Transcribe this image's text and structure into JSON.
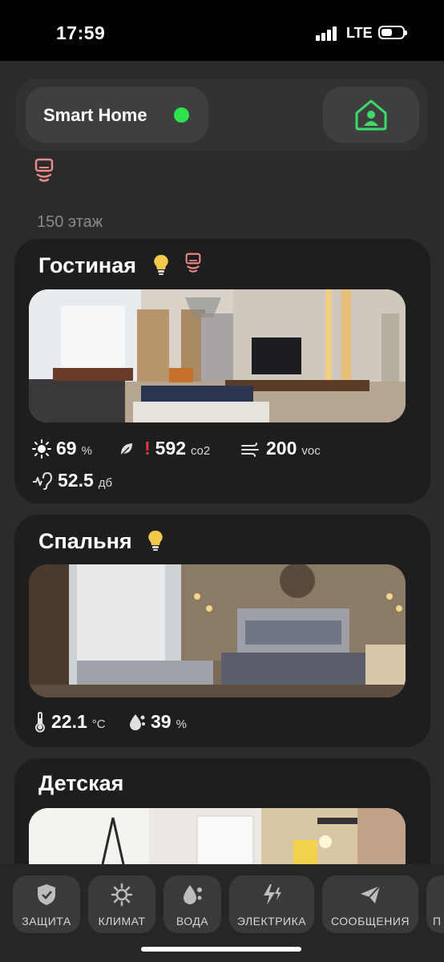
{
  "status_bar": {
    "time": "17:59",
    "network": "LTE",
    "battery_level": 0.5
  },
  "header": {
    "title": "Smart Home",
    "status_color": "#2ee24a",
    "profile_icon": "home-user-icon"
  },
  "floor_label": "150 этаж",
  "rooms": [
    {
      "name": "Гостиная",
      "icons": [
        "lightbulb-icon",
        "sensor-icon"
      ],
      "metrics": {
        "light": {
          "value": "69",
          "unit": "%"
        },
        "co2": {
          "value": "592",
          "unit": "co2",
          "alert": "!"
        },
        "voc": {
          "value": "200",
          "unit": "voc"
        },
        "noise": {
          "value": "52.5",
          "unit": "дб"
        }
      }
    },
    {
      "name": "Спальня",
      "icons": [
        "lightbulb-icon"
      ],
      "metrics": {
        "temperature": {
          "value": "22.1",
          "unit": "°C"
        },
        "humidity": {
          "value": "39",
          "unit": "%"
        }
      }
    },
    {
      "name": "Детская",
      "icons": []
    }
  ],
  "nav": [
    {
      "label": "ЗАЩИТА",
      "icon": "shield-icon"
    },
    {
      "label": "КЛИМАТ",
      "icon": "climate-icon"
    },
    {
      "label": "ВОДА",
      "icon": "water-icon"
    },
    {
      "label": "ЭЛЕКТРИКА",
      "icon": "electricity-icon"
    },
    {
      "label": "СООБЩЕНИЯ",
      "icon": "messages-icon"
    },
    {
      "label": "П",
      "icon": "more-icon"
    }
  ],
  "colors": {
    "accent_green": "#3ddc6a",
    "sensor_pink": "#f08a8a",
    "alert_red": "#e53935",
    "bulb_yellow": "#f2c94c"
  }
}
